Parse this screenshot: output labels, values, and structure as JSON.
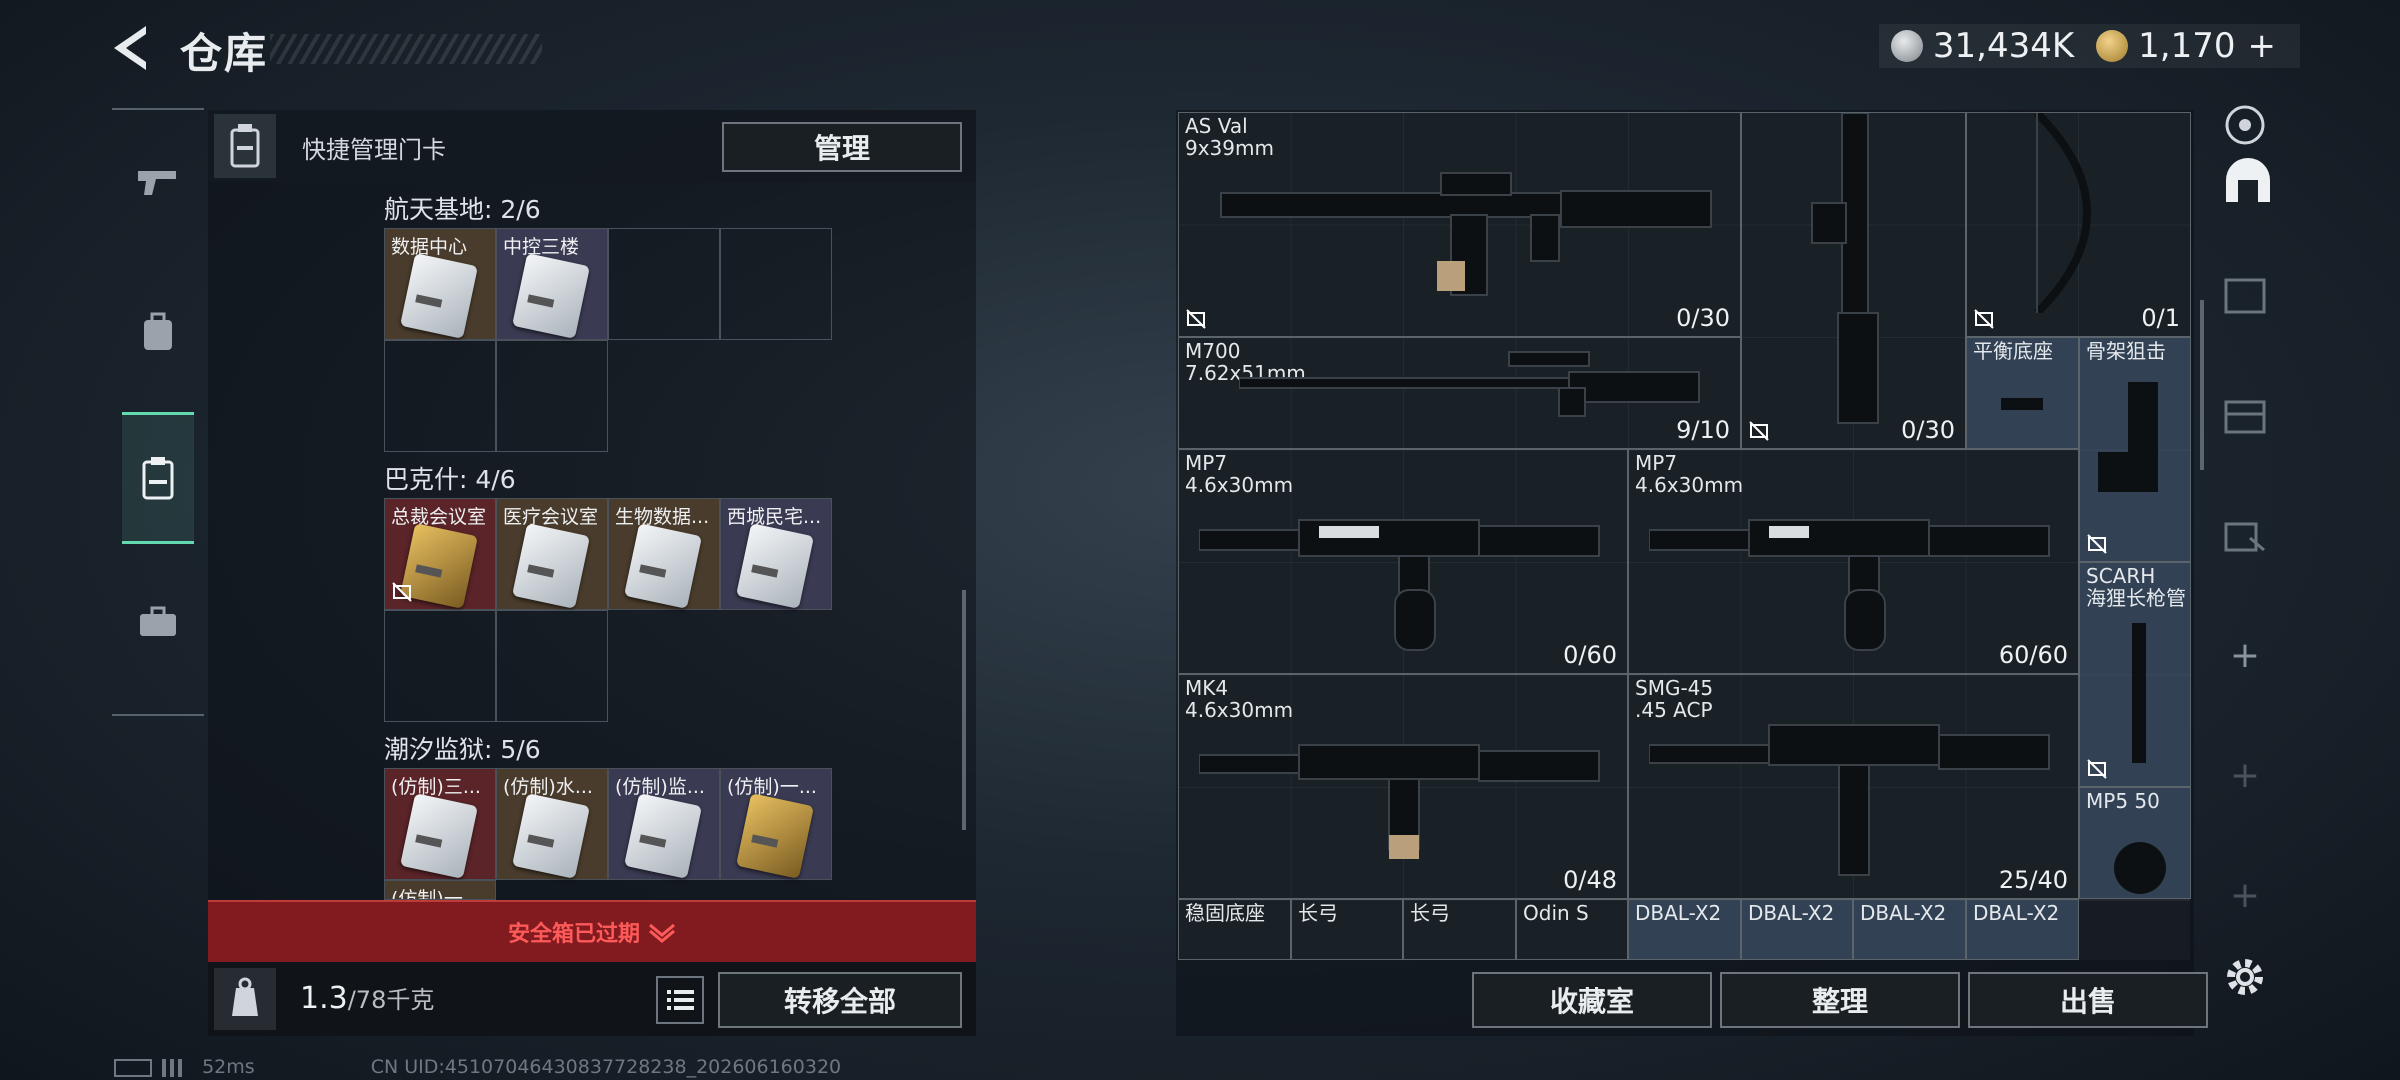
{
  "header": {
    "title": "仓库",
    "currency_silver": "31,434K",
    "currency_gold": "1,170",
    "plus": "+"
  },
  "left_panel": {
    "header_label": "快捷管理门卡",
    "manage_button": "管理",
    "zones": [
      {
        "title": "航天基地: 2/6",
        "cards": [
          "数据中心",
          "中控三楼"
        ]
      },
      {
        "title": "巴克什: 4/6",
        "cards": [
          "总裁会议室",
          "医疗会议室",
          "生物数据...",
          "西城民宅..."
        ]
      },
      {
        "title": "潮汐监狱: 5/6",
        "cards": [
          "(仿制)三...",
          "(仿制)水...",
          "(仿制)监...",
          "(仿制)一...",
          "(仿制)一..."
        ]
      }
    ],
    "expired_text": "安全箱已过期",
    "weight_value": "1.3",
    "weight_capacity": "/78千克",
    "transfer_all_button": "转移全部"
  },
  "stash_items": [
    {
      "name": "AS Val",
      "caliber": "9x39mm",
      "count": "0/30"
    },
    {
      "name": "",
      "caliber": "",
      "count": "0/30"
    },
    {
      "name": "",
      "caliber": "",
      "count": "0/1"
    },
    {
      "name": "M700",
      "caliber": "7.62x51mm",
      "count": "9/10"
    },
    {
      "name": "平衡底座",
      "caliber": "",
      "count": ""
    },
    {
      "name": "骨架狙击",
      "caliber": "",
      "count": ""
    },
    {
      "name": "MP7",
      "caliber": "4.6x30mm",
      "count": "0/60"
    },
    {
      "name": "MP7",
      "caliber": "4.6x30mm",
      "count": "60/60"
    },
    {
      "name": "SCARH",
      "caliber": "海狸长枪管",
      "count": ""
    },
    {
      "name": "MK4",
      "caliber": "4.6x30mm",
      "count": "0/48"
    },
    {
      "name": "SMG-45",
      "caliber": ".45 ACP",
      "count": "25/40"
    },
    {
      "name": "MP5 50",
      "caliber": "",
      "count": ""
    },
    {
      "name": "稳固底座",
      "caliber": "",
      "count": ""
    },
    {
      "name": "长弓",
      "caliber": "",
      "count": ""
    },
    {
      "name": "长弓",
      "caliber": "",
      "count": ""
    },
    {
      "name": "Odin S",
      "caliber": "",
      "count": ""
    },
    {
      "name": "DBAL-X2",
      "caliber": "",
      "count": ""
    },
    {
      "name": "DBAL-X2",
      "caliber": "",
      "count": ""
    },
    {
      "name": "DBAL-X2",
      "caliber": "",
      "count": ""
    },
    {
      "name": "DBAL-X2",
      "caliber": "",
      "count": ""
    }
  ],
  "right_buttons": {
    "collection": "收藏室",
    "organize": "整理",
    "sell": "出售"
  },
  "footer": {
    "ping": "52ms",
    "uid": "CN UID:45107046430837728238_202606160320"
  },
  "icons": {
    "nav": [
      "pistol-icon",
      "backpack-icon",
      "keycard-icon",
      "briefcase-icon"
    ],
    "side": [
      "target-icon",
      "safehouse-icon",
      "workbench-icon",
      "storage-icon",
      "transfer-icon",
      "add-icon",
      "settings-icon"
    ]
  }
}
